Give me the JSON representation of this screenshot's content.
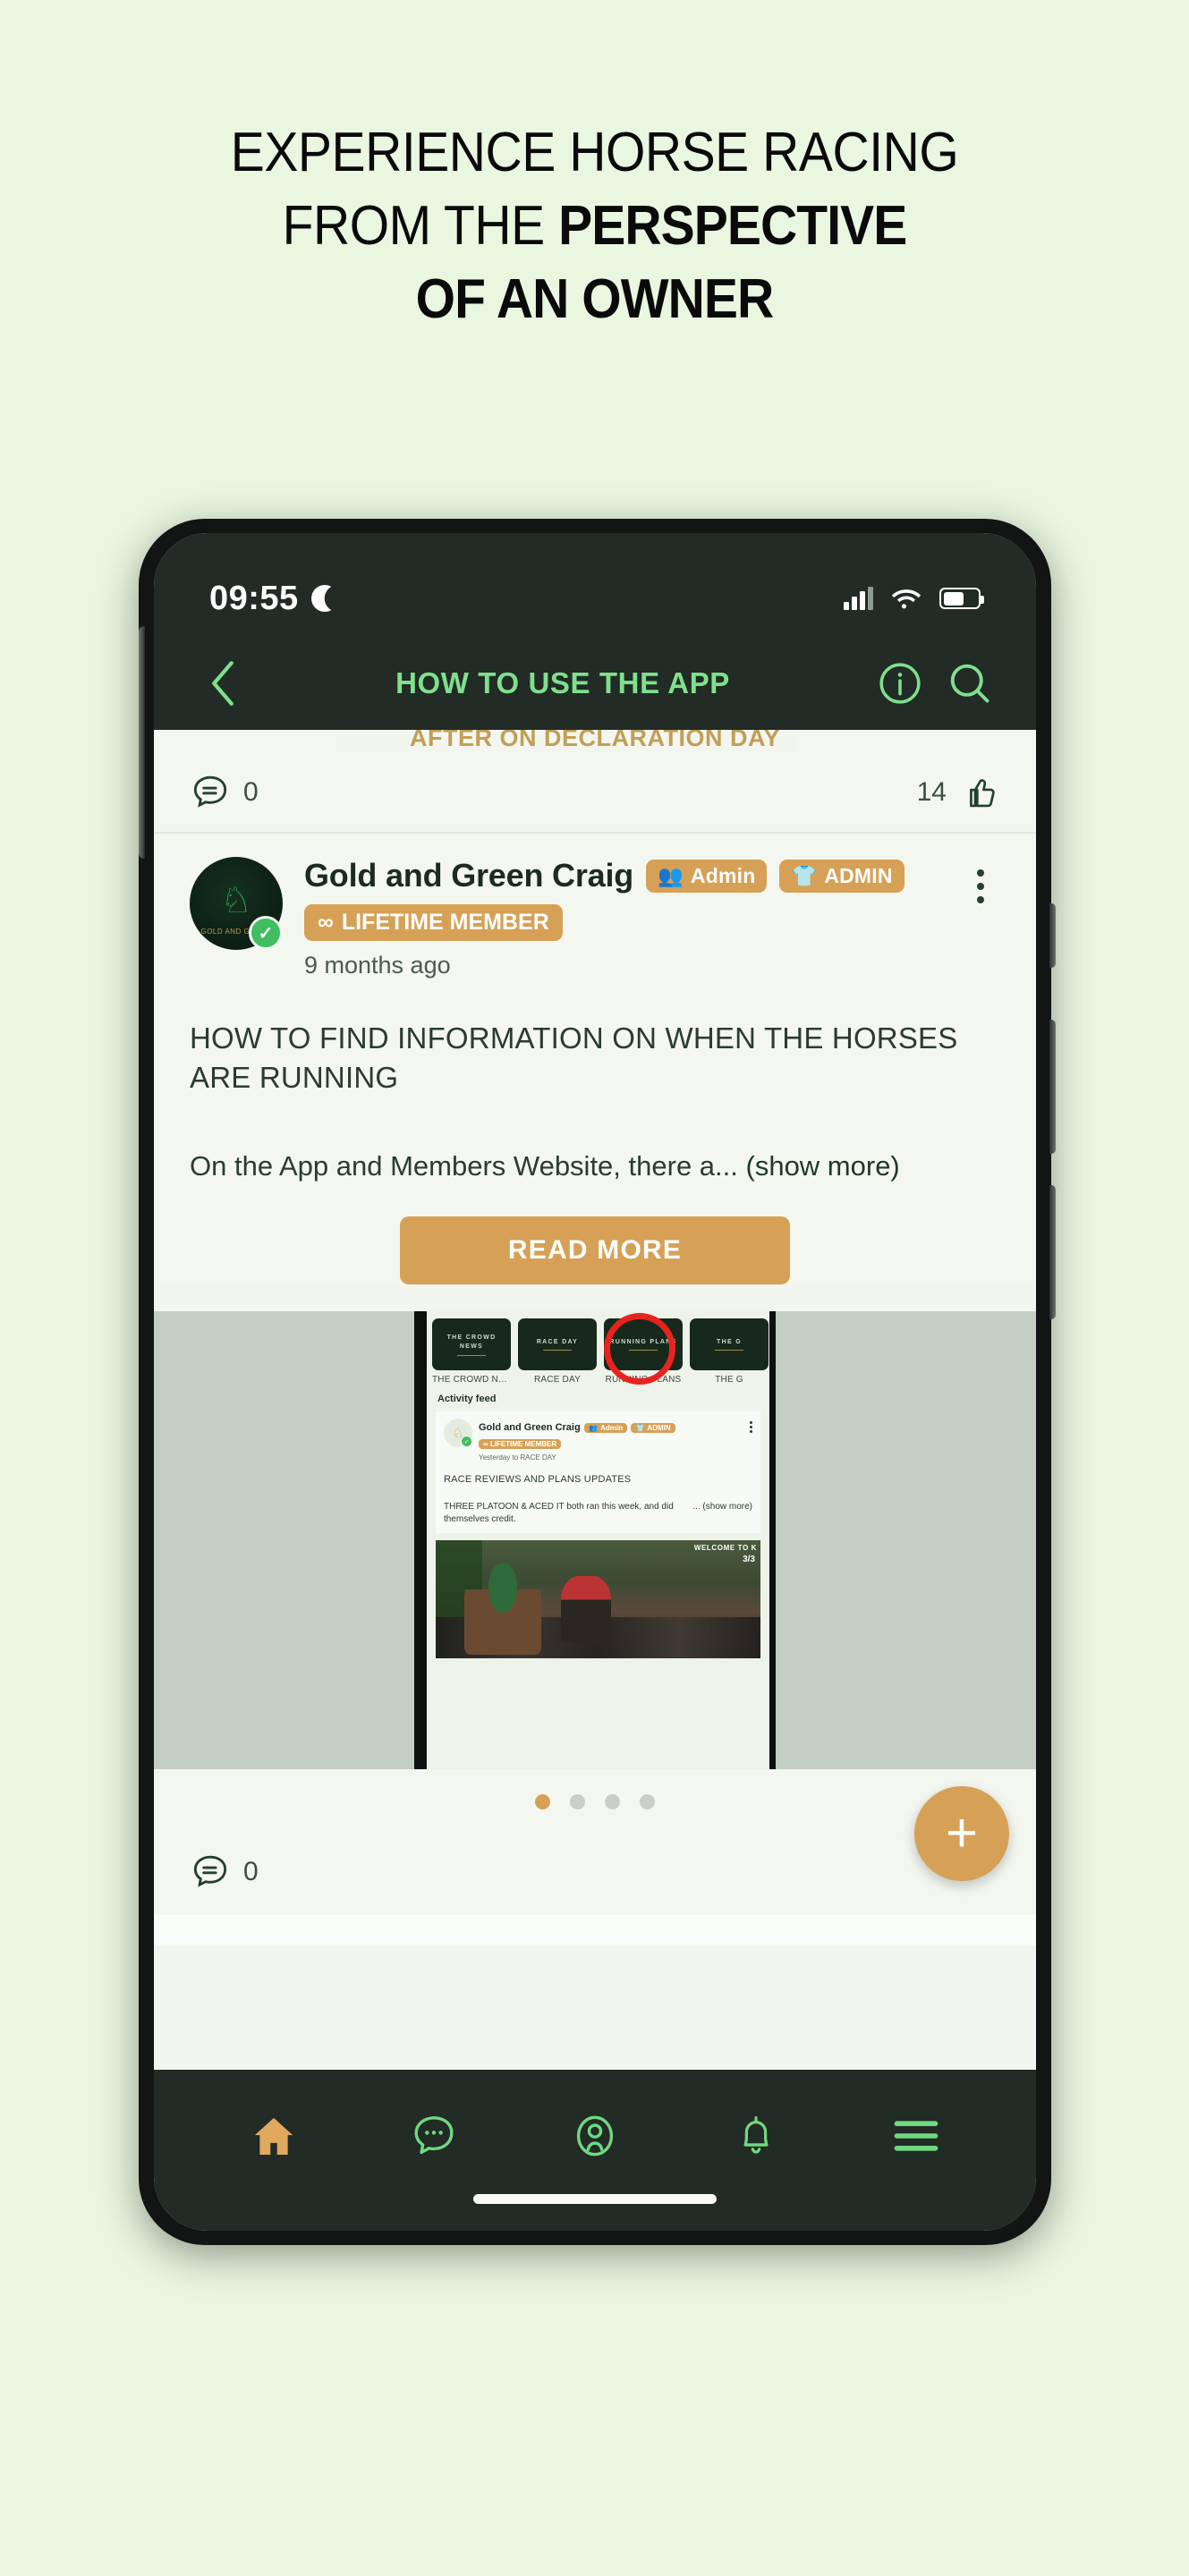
{
  "headline": {
    "line1": "EXPERIENCE HORSE RACING",
    "line2_regular": "FROM THE ",
    "line2_bold": "PERSPECTIVE",
    "line3_bold": "OF AN OWNER"
  },
  "colors": {
    "page_background": "#e9f7e0",
    "app_dark": "#222b26",
    "accent_green": "#7fe08c",
    "accent_gold": "#d6a156",
    "annotation_red": "#e8231f",
    "screen_background": "#f3f7f0"
  },
  "statusbar": {
    "time": "09:55",
    "dnd_icon": "crescent-moon-icon",
    "signal_icon": "cellular-signal-icon",
    "wifi_icon": "wifi-icon",
    "battery_icon": "battery-icon"
  },
  "navbar": {
    "back_icon": "chevron-left-icon",
    "title": "HOW TO USE THE APP",
    "info_icon": "info-circle-icon",
    "search_icon": "search-icon"
  },
  "peek_text": "AFTER ON DECLARATION DAY",
  "top_engagement": {
    "comment_icon": "comment-bubble-icon",
    "comment_count": "0",
    "like_count": "14",
    "like_icon": "thumbs-up-icon"
  },
  "post": {
    "author": "Gold and Green Craig",
    "badge_admin_people": "Admin",
    "badge_admin_shirt": "ADMIN",
    "badge_lifetime": "LIFETIME MEMBER",
    "badge_lifetime_icon": "infinity-icon",
    "badge_people_icon": "people-icon",
    "badge_shirt_icon": "jersey-icon",
    "timestamp": "9 months ago",
    "verified_icon": "verified-check-icon",
    "menu_icon": "kebab-menu-icon",
    "title": "HOW TO FIND INFORMATION ON WHEN THE HORSES ARE RUNNING",
    "body_preview": "On the App and Members Website, there a...",
    "show_more": "(show more)",
    "read_more_button": "READ MORE"
  },
  "embedded_screenshot": {
    "tiles": [
      {
        "tile_title": "THE CROWD NEWS",
        "label": "THE CROWD NE...",
        "highlighted": false
      },
      {
        "tile_title": "RACE DAY",
        "label": "RACE DAY",
        "highlighted": false
      },
      {
        "tile_title": "RUNNING PLANS",
        "label": "RUNNING PLANS",
        "highlighted": true
      },
      {
        "tile_title": "THE G",
        "label": "THE G",
        "highlighted": false
      }
    ],
    "feed_heading": "Activity feed",
    "inner_post": {
      "author": "Gold and Green Craig",
      "badge_admin_people": "Admin",
      "badge_admin_shirt": "ADMIN",
      "badge_lifetime": "LIFETIME MEMBER",
      "meta": "Yesterday to RACE DAY",
      "title": "RACE REVIEWS AND PLANS UPDATES",
      "body": "THREE PLATOON & ACED IT both ran this week, and did themselves credit.",
      "show_more": "... (show more)"
    },
    "photo_overlay_text": "WELCOME TO K",
    "photo_counter": "3/3"
  },
  "carousel": {
    "dots": 4,
    "active_index": 0
  },
  "bottom_engagement": {
    "comment_icon": "comment-bubble-icon",
    "comment_count": "0",
    "fab_label": "+"
  },
  "tabbar": {
    "items": [
      {
        "name": "home",
        "icon": "home-icon",
        "active": true
      },
      {
        "name": "messages",
        "icon": "chat-bubble-icon",
        "active": false
      },
      {
        "name": "profile",
        "icon": "user-circle-icon",
        "active": false
      },
      {
        "name": "notifications",
        "icon": "bell-icon",
        "active": false
      },
      {
        "name": "menu",
        "icon": "hamburger-menu-icon",
        "active": false
      }
    ]
  }
}
